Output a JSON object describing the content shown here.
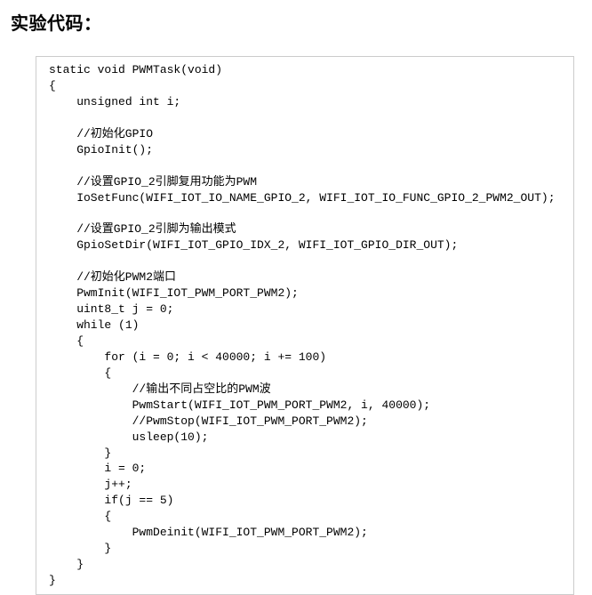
{
  "heading": "实验代码：",
  "code": "static void PWMTask(void)\n{\n    unsigned int i;\n\n    //初始化GPIO\n    GpioInit();\n\n    //设置GPIO_2引脚复用功能为PWM\n    IoSetFunc(WIFI_IOT_IO_NAME_GPIO_2, WIFI_IOT_IO_FUNC_GPIO_2_PWM2_OUT);\n\n    //设置GPIO_2引脚为输出模式\n    GpioSetDir(WIFI_IOT_GPIO_IDX_2, WIFI_IOT_GPIO_DIR_OUT);\n\n    //初始化PWM2端口\n    PwmInit(WIFI_IOT_PWM_PORT_PWM2);\n    uint8_t j = 0;\n    while (1)\n    {\n        for (i = 0; i < 40000; i += 100)\n        {\n            //输出不同占空比的PWM波\n            PwmStart(WIFI_IOT_PWM_PORT_PWM2, i, 40000);\n            //PwmStop(WIFI_IOT_PWM_PORT_PWM2);\n            usleep(10);\n        }\n        i = 0;\n        j++;\n        if(j == 5)\n        {\n            PwmDeinit(WIFI_IOT_PWM_PORT_PWM2);\n        }\n    }\n}"
}
